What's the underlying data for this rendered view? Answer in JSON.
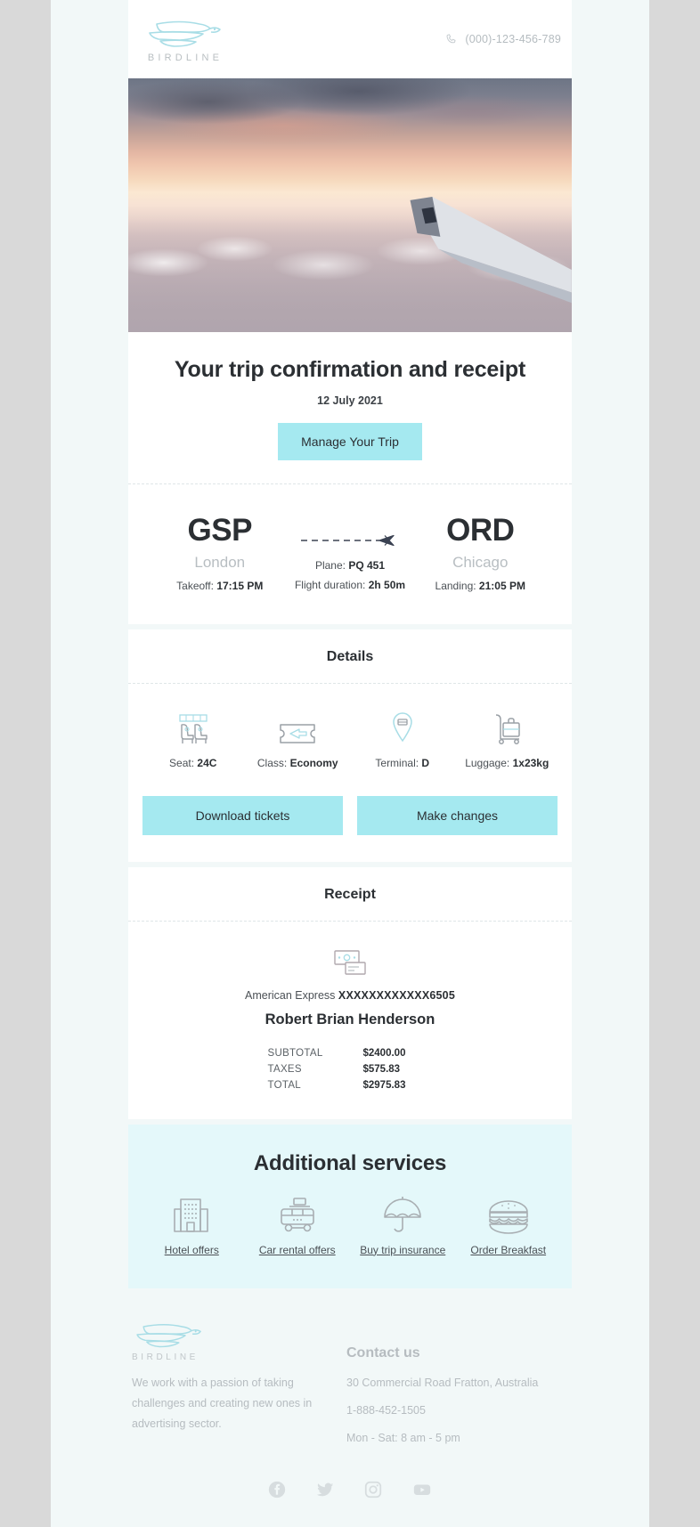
{
  "header": {
    "logo_word": "BIRDLINE",
    "phone_icon": "phone-icon",
    "phone": "(000)-123-456-789"
  },
  "hero": {
    "alt": "airplane-wing-above-clouds-at-sunset"
  },
  "intro": {
    "title": "Your trip confirmation and receipt",
    "date": "12 July 2021",
    "cta": "Manage Your Trip"
  },
  "route": {
    "origin": {
      "code": "GSP",
      "city": "London",
      "time_label": "Takeoff:",
      "time": "17:15 PM"
    },
    "destination": {
      "code": "ORD",
      "city": "Chicago",
      "time_label": "Landing:",
      "time": "21:05 PM"
    },
    "middle": {
      "plane_label": "Plane:",
      "plane_value": "PQ 451",
      "duration_label": "Flight duration:",
      "duration_value": "2h 50m"
    }
  },
  "details": {
    "heading": "Details",
    "items": [
      {
        "icon": "airplane-seat-icon",
        "label": "Seat:",
        "value": "24C"
      },
      {
        "icon": "ticket-icon",
        "label": "Class:",
        "value": "Economy"
      },
      {
        "icon": "terminal-pin-icon",
        "label": "Terminal:",
        "value": "D"
      },
      {
        "icon": "luggage-cart-icon",
        "label": "Luggage:",
        "value": "1x23kg"
      }
    ],
    "download_button": "Download tickets",
    "changes_button": "Make changes"
  },
  "receipt": {
    "heading": "Receipt",
    "icon": "cash-and-card-icon",
    "card_issuer": "American Express",
    "card_number": "XXXXXXXXXXXX6505",
    "holder": "Robert Brian Henderson",
    "lines": [
      {
        "label": "SUBTOTAL",
        "value": "$2400.00"
      },
      {
        "label": "TAXES",
        "value": "$575.83"
      },
      {
        "label": "TOTAL",
        "value": "$2975.83"
      }
    ]
  },
  "services": {
    "heading": "Additional services",
    "items": [
      {
        "icon": "hotel-building-icon",
        "label": "Hotel offers"
      },
      {
        "icon": "car-rental-icon",
        "label": "Car rental offers"
      },
      {
        "icon": "umbrella-icon",
        "label": "Buy trip insurance"
      },
      {
        "icon": "burger-icon",
        "label": "Order Breakfast"
      }
    ]
  },
  "footer": {
    "logo_word": "BIRDLINE",
    "tagline": "We work with a passion of taking challenges and creating new ones in advertising sector.",
    "contact_heading": "Contact us",
    "address": "30 Commercial Road Fratton, Australia",
    "phone": "1-888-452-1505",
    "hours": "Mon - Sat: 8 am - 5 pm",
    "socials": [
      {
        "icon": "facebook-icon"
      },
      {
        "icon": "twitter-icon"
      },
      {
        "icon": "instagram-icon"
      },
      {
        "icon": "youtube-icon"
      }
    ]
  },
  "colors": {
    "accent": "#a5e9f0",
    "services_bg": "#e4f8fa",
    "page_bg": "#f2f8f8",
    "outer_bg": "#d9d9d9",
    "text_dark": "#2b2f33",
    "text_muted": "#b6bcc0"
  }
}
